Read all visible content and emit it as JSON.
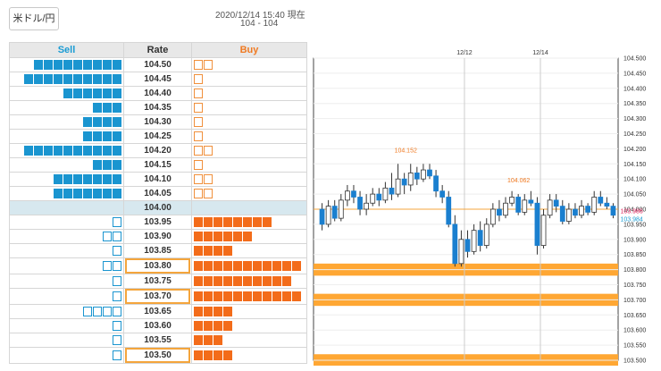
{
  "header": {
    "pair_label": "米ドル/円",
    "timestamp": "2020/12/14 15:40 現在",
    "range": "104 - 104"
  },
  "table": {
    "headers": {
      "sell": "Sell",
      "rate": "Rate",
      "buy": "Buy"
    },
    "rows": [
      {
        "rate": "104.50",
        "sell": 9,
        "sell_empty": 0,
        "buy": 0,
        "buy_empty": 2,
        "highlight": false,
        "mid": false
      },
      {
        "rate": "104.45",
        "sell": 10,
        "sell_empty": 0,
        "buy": 0,
        "buy_empty": 1,
        "highlight": false,
        "mid": false
      },
      {
        "rate": "104.40",
        "sell": 6,
        "sell_empty": 0,
        "buy": 0,
        "buy_empty": 1,
        "highlight": false,
        "mid": false
      },
      {
        "rate": "104.35",
        "sell": 3,
        "sell_empty": 0,
        "buy": 0,
        "buy_empty": 1,
        "highlight": false,
        "mid": false
      },
      {
        "rate": "104.30",
        "sell": 4,
        "sell_empty": 0,
        "buy": 0,
        "buy_empty": 1,
        "highlight": false,
        "mid": false
      },
      {
        "rate": "104.25",
        "sell": 4,
        "sell_empty": 0,
        "buy": 0,
        "buy_empty": 1,
        "highlight": false,
        "mid": false
      },
      {
        "rate": "104.20",
        "sell": 10,
        "sell_empty": 0,
        "buy": 0,
        "buy_empty": 2,
        "highlight": false,
        "mid": false
      },
      {
        "rate": "104.15",
        "sell": 3,
        "sell_empty": 0,
        "buy": 0,
        "buy_empty": 1,
        "highlight": false,
        "mid": false
      },
      {
        "rate": "104.10",
        "sell": 7,
        "sell_empty": 0,
        "buy": 0,
        "buy_empty": 2,
        "highlight": false,
        "mid": false
      },
      {
        "rate": "104.05",
        "sell": 7,
        "sell_empty": 0,
        "buy": 0,
        "buy_empty": 2,
        "highlight": false,
        "mid": false
      },
      {
        "rate": "104.00",
        "sell": 0,
        "sell_empty": 0,
        "buy": 0,
        "buy_empty": 0,
        "highlight": false,
        "mid": true
      },
      {
        "rate": "103.95",
        "sell": 0,
        "sell_empty": 1,
        "buy": 8,
        "buy_empty": 0,
        "highlight": false,
        "mid": false
      },
      {
        "rate": "103.90",
        "sell": 0,
        "sell_empty": 2,
        "buy": 6,
        "buy_empty": 0,
        "highlight": false,
        "mid": false
      },
      {
        "rate": "103.85",
        "sell": 0,
        "sell_empty": 1,
        "buy": 4,
        "buy_empty": 0,
        "highlight": false,
        "mid": false
      },
      {
        "rate": "103.80",
        "sell": 0,
        "sell_empty": 2,
        "buy": 11,
        "buy_empty": 0,
        "highlight": true,
        "mid": false
      },
      {
        "rate": "103.75",
        "sell": 0,
        "sell_empty": 1,
        "buy": 10,
        "buy_empty": 0,
        "highlight": false,
        "mid": false
      },
      {
        "rate": "103.70",
        "sell": 0,
        "sell_empty": 1,
        "buy": 11,
        "buy_empty": 0,
        "highlight": true,
        "mid": false
      },
      {
        "rate": "103.65",
        "sell": 0,
        "sell_empty": 4,
        "buy": 4,
        "buy_empty": 0,
        "highlight": false,
        "mid": false
      },
      {
        "rate": "103.60",
        "sell": 0,
        "sell_empty": 1,
        "buy": 4,
        "buy_empty": 0,
        "highlight": false,
        "mid": false
      },
      {
        "rate": "103.55",
        "sell": 0,
        "sell_empty": 1,
        "buy": 3,
        "buy_empty": 0,
        "highlight": false,
        "mid": false
      },
      {
        "rate": "103.50",
        "sell": 0,
        "sell_empty": 1,
        "buy": 4,
        "buy_empty": 0,
        "highlight": true,
        "mid": false
      }
    ]
  },
  "chart_data": {
    "type": "candlestick",
    "x_labels": [
      {
        "label": "12/12",
        "index": 23
      },
      {
        "label": "12/14",
        "index": 35
      }
    ],
    "ylim": [
      103.5,
      104.5
    ],
    "yticks": [
      "104.500",
      "104.450",
      "104.400",
      "104.350",
      "104.300",
      "104.250",
      "104.200",
      "104.150",
      "104.100",
      "104.050",
      "104.000",
      "103.950",
      "103.900",
      "103.850",
      "103.800",
      "103.750",
      "103.700",
      "103.650",
      "103.600",
      "103.550",
      "103.500"
    ],
    "reference_line": 104.0,
    "bands": [
      {
        "from": 103.78,
        "to": 103.82
      },
      {
        "from": 103.68,
        "to": 103.72
      },
      {
        "from": 103.48,
        "to": 103.52
      }
    ],
    "candles": [
      [
        104.0,
        103.95,
        104.02,
        103.93
      ],
      [
        103.95,
        104.01,
        104.03,
        103.94
      ],
      [
        104.01,
        103.97,
        104.03,
        103.96
      ],
      [
        103.97,
        104.03,
        104.05,
        103.96
      ],
      [
        104.03,
        104.06,
        104.08,
        104.01
      ],
      [
        104.06,
        104.04,
        104.08,
        104.02
      ],
      [
        104.04,
        104.0,
        104.06,
        103.98
      ],
      [
        104.0,
        104.02,
        104.05,
        103.98
      ],
      [
        104.02,
        104.05,
        104.07,
        104.01
      ],
      [
        104.05,
        104.03,
        104.07,
        104.01
      ],
      [
        104.03,
        104.07,
        104.09,
        104.02
      ],
      [
        104.07,
        104.05,
        104.12,
        104.03
      ],
      [
        104.05,
        104.1,
        104.15,
        104.04
      ],
      [
        104.1,
        104.08,
        104.12,
        104.05
      ],
      [
        104.08,
        104.12,
        104.15,
        104.06
      ],
      [
        104.12,
        104.1,
        104.14,
        104.08
      ],
      [
        104.1,
        104.13,
        104.15,
        104.09
      ],
      [
        104.13,
        104.11,
        104.15,
        104.1
      ],
      [
        104.11,
        104.06,
        104.13,
        104.04
      ],
      [
        104.06,
        104.04,
        104.08,
        104.02
      ],
      [
        104.04,
        103.95,
        104.06,
        103.94
      ],
      [
        103.95,
        103.82,
        103.98,
        103.81
      ],
      [
        103.82,
        103.9,
        103.93,
        103.81
      ],
      [
        103.9,
        103.86,
        103.93,
        103.84
      ],
      [
        103.86,
        103.93,
        103.95,
        103.85
      ],
      [
        103.93,
        103.88,
        103.96,
        103.86
      ],
      [
        103.88,
        103.95,
        103.97,
        103.87
      ],
      [
        103.95,
        104.0,
        104.02,
        103.94
      ],
      [
        104.0,
        103.98,
        104.03,
        103.96
      ],
      [
        103.98,
        104.02,
        104.04,
        103.97
      ],
      [
        104.02,
        104.04,
        104.06,
        104.01
      ],
      [
        104.04,
        103.99,
        104.05,
        103.98
      ],
      [
        103.99,
        104.03,
        104.05,
        103.98
      ],
      [
        104.03,
        104.02,
        104.06,
        104.01
      ],
      [
        104.02,
        103.88,
        104.04,
        103.85
      ],
      [
        103.88,
        103.98,
        104.0,
        103.87
      ],
      [
        103.98,
        104.03,
        104.05,
        103.97
      ],
      [
        104.03,
        104.01,
        104.05,
        103.99
      ],
      [
        104.01,
        103.96,
        104.03,
        103.95
      ],
      [
        103.96,
        104.0,
        104.02,
        103.95
      ],
      [
        104.0,
        103.98,
        104.02,
        103.97
      ],
      [
        103.98,
        104.01,
        104.03,
        103.97
      ],
      [
        104.01,
        103.99,
        104.02,
        103.98
      ],
      [
        103.99,
        104.04,
        104.06,
        103.98
      ],
      [
        104.04,
        104.02,
        104.06,
        104.01
      ],
      [
        104.02,
        104.01,
        104.04,
        104.0
      ],
      [
        104.01,
        103.98,
        104.02,
        103.97
      ]
    ],
    "annotations": [
      {
        "text": "104.152",
        "value": 104.152,
        "color": "#f07a22"
      },
      {
        "text": "104.062",
        "value": 104.062,
        "color": "#f07a22"
      },
      {
        "text": "103.986",
        "value": 103.986,
        "color": "#e0245e"
      },
      {
        "text": "103.984",
        "value": 103.984,
        "color": "#1a9cd4"
      }
    ]
  }
}
